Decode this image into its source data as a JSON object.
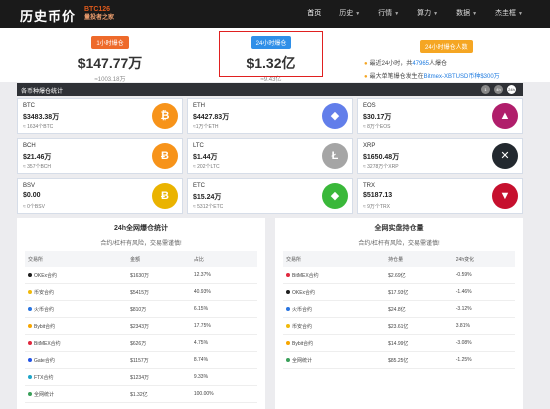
{
  "nav": {
    "logo": "历史币价",
    "brand_top": "BTC126",
    "brand_bottom": "量投者之家",
    "menu": [
      {
        "label": "首页",
        "caret": false
      },
      {
        "label": "历史",
        "caret": true
      },
      {
        "label": "行情",
        "caret": true
      },
      {
        "label": "算力",
        "caret": true
      },
      {
        "label": "数据",
        "caret": true
      },
      {
        "label": "杰圭框",
        "caret": true
      }
    ]
  },
  "stats": {
    "one": {
      "badge": "1小时爆仓",
      "value": "$147.77万",
      "sub": "≈1003.18万"
    },
    "two": {
      "badge": "24小时爆仓",
      "value": "$1.32亿",
      "sub": "≈9.43亿"
    },
    "three": {
      "badge": "24小时爆仓人数",
      "line1a": "最近24小时，共",
      "line1b": "47965",
      "line1c": "人爆仓",
      "line2a": "最大单笔爆仓发生在",
      "line2b": "Bitmex-XBTUSD币种$300万"
    }
  },
  "bar": {
    "title": "各币种爆仓统计",
    "btn1": "1",
    "btn2": "4h",
    "btn3": "24h"
  },
  "coins": [
    {
      "name": "BTC",
      "price": "$3483.38万",
      "sub": "≈ 1634个BTC",
      "color": "#f7931a",
      "glyph": "₿",
      "icon": "bitcoin-icon"
    },
    {
      "name": "ETH",
      "price": "$4427.83万",
      "sub": "≈1万个ETH",
      "color": "#627eea",
      "glyph": "◆",
      "icon": "ethereum-icon"
    },
    {
      "name": "EOS",
      "price": "$30.17万",
      "sub": "≈ 8万个EOS",
      "color": "#b01e6b",
      "glyph": "▲",
      "icon": "eos-icon"
    },
    {
      "name": "BCH",
      "price": "$21.46万",
      "sub": "≈ 357个BCH",
      "color": "#f7931a",
      "glyph": "Ƀ",
      "icon": "bitcoin-cash-icon"
    },
    {
      "name": "LTC",
      "price": "$1.44万",
      "sub": "≈ 202个LTC",
      "color": "#a5a5a5",
      "glyph": "Ł",
      "icon": "litecoin-icon"
    },
    {
      "name": "XRP",
      "price": "$1650.48万",
      "sub": "≈ 3278万个XRP",
      "color": "#23292f",
      "glyph": "✕",
      "icon": "ripple-icon"
    },
    {
      "name": "BSV",
      "price": "$0.00",
      "sub": "≈ 0个BSV",
      "color": "#eab300",
      "glyph": "Ƀ",
      "icon": "bitcoin-sv-icon"
    },
    {
      "name": "ETC",
      "price": "$15.24万",
      "sub": "≈ 5312个ETC",
      "color": "#3ab83a",
      "glyph": "◆",
      "icon": "ethereum-classic-icon"
    },
    {
      "name": "TRX",
      "price": "$5187.13",
      "sub": "≈ 9万个TRX",
      "color": "#c6102e",
      "glyph": "▼",
      "icon": "tron-icon"
    }
  ],
  "left_panel": {
    "title": "24h全网爆仓统计",
    "warn": "合约/杠杆有风险，交易需谨慎!",
    "headers": [
      "交易所",
      "金额",
      "占比"
    ],
    "rows": [
      {
        "ex": "OKEx合约",
        "amt": "$1630万",
        "pct": "12.37%",
        "c": "#1e1e1e"
      },
      {
        "ex": "币安合约",
        "amt": "$5415万",
        "pct": "40.93%",
        "c": "#f0b90b"
      },
      {
        "ex": "火币合约",
        "amt": "$810万",
        "pct": "6.15%",
        "c": "#2a75e0"
      },
      {
        "ex": "Bybit合约",
        "amt": "$2343万",
        "pct": "17.75%",
        "c": "#f7a600"
      },
      {
        "ex": "BitMEX合约",
        "amt": "$626万",
        "pct": "4.75%",
        "c": "#e0283e"
      },
      {
        "ex": "Gate合约",
        "amt": "$1157万",
        "pct": "8.74%",
        "c": "#2354e6"
      },
      {
        "ex": "FTX合约",
        "amt": "$1234万",
        "pct": "9.33%",
        "c": "#1ea5c8"
      },
      {
        "ex": "全网统计",
        "amt": "$1.32亿",
        "pct": "100.00%",
        "c": "#3aa05a"
      }
    ]
  },
  "right_panel": {
    "title": "全网实盘持仓量",
    "warn": "合约/杠杆有风险，交易需谨慎!",
    "headers": [
      "交易所",
      "持仓量",
      "24h变化"
    ],
    "rows": [
      {
        "ex": "BitMEX合约",
        "amt": "$2.69亿",
        "pct": "-0.59%",
        "c": "#e0283e"
      },
      {
        "ex": "OKEx合约",
        "amt": "$17.93亿",
        "pct": "-1.46%",
        "c": "#1e1e1e"
      },
      {
        "ex": "火币合约",
        "amt": "$24.8亿",
        "pct": "-3.12%",
        "c": "#2a75e0"
      },
      {
        "ex": "币安合约",
        "amt": "$23.61亿",
        "pct": "3.81%",
        "c": "#f0b90b"
      },
      {
        "ex": "Bybit合约",
        "amt": "$14.99亿",
        "pct": "-3.08%",
        "c": "#f7a600"
      },
      {
        "ex": "全网统计",
        "amt": "$85.25亿",
        "pct": "-1.25%",
        "c": "#3aa05a"
      }
    ]
  }
}
